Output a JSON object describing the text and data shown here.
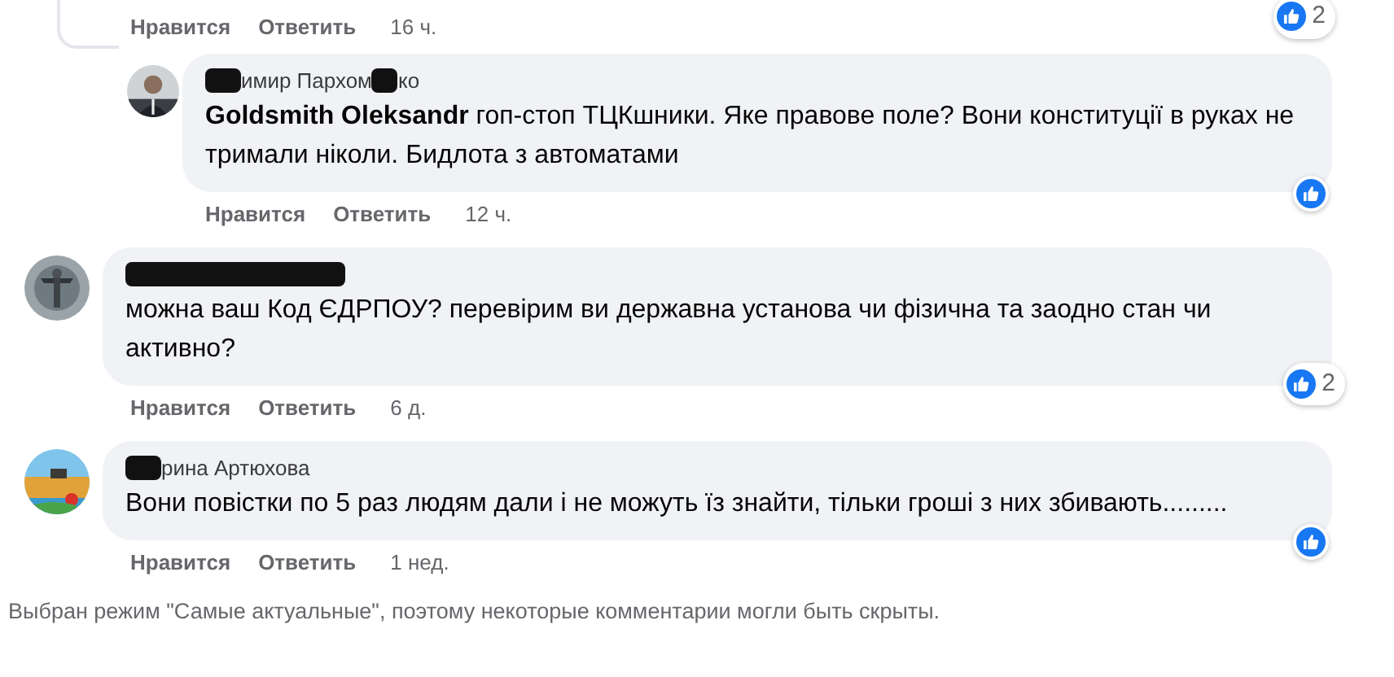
{
  "top_actions": {
    "like": "Нравится",
    "reply": "Ответить",
    "time": "16 ч.",
    "reaction_count": "2"
  },
  "comments": [
    {
      "kind": "reply",
      "author_parts": [
        "имир Пархом",
        "ко"
      ],
      "mention": "Goldsmith Oleksandr",
      "text": "гоп-стоп ТЦКшники. Яке правове поле? Вони конституції в руках не тримали ніколи. Бидлота з автоматами",
      "like": "Нравится",
      "reply": "Ответить",
      "time": "12 ч."
    },
    {
      "kind": "top",
      "text": "можна ваш Код ЄДРПОУ? перевірим ви державна установа чи фізична та заодно стан чи активно?",
      "like": "Нравится",
      "reply": "Ответить",
      "time": "6 д.",
      "reaction_count": "2"
    },
    {
      "kind": "top",
      "author_parts": [
        "рина Артюхова"
      ],
      "text": "Вони повістки по 5 раз людям дали і не можуть їз знайти, тільки гроші з них збивають.........",
      "like": "Нравится",
      "reply": "Ответить",
      "time": "1 нед."
    }
  ],
  "footer": "Выбран режим \"Самые актуальные\", поэтому некоторые комментарии могли быть скрыты."
}
